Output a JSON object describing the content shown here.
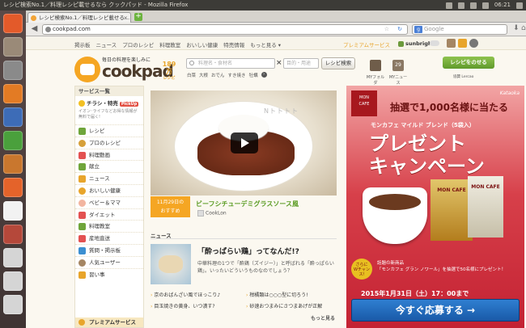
{
  "os": {
    "window_title": "レシピ検索No.1／料理レシピ載せるなら クックパッド - Mozilla Firefox",
    "clock": "06:21"
  },
  "browser": {
    "tab_title": "レシピ検索No.1／料理レシピ載せる...",
    "tab_close": "×",
    "new_tab": "+",
    "url": "cookpad.com",
    "search_placeholder": "Google",
    "search_engine": "g"
  },
  "header": {
    "links": [
      "掲示板",
      "ニュース",
      "プロのレシピ",
      "料理教室",
      "おいしい健康",
      "特売情報",
      "もっと見る ▾"
    ],
    "premium": "プレミアムサービス",
    "username": "sunbright",
    "logo_tagline": "毎日の料理を楽しみに",
    "logo_word": "cookpad",
    "recipe_count": "189万",
    "recipe_count_unit": "レシピ",
    "recipe_placeholder": "料理名・食材名",
    "clear": "×",
    "purpose_placeholder": "目的・用途",
    "search_button": "レシピ検索",
    "keywords": [
      "白菜",
      "大根",
      "おでん",
      "すき焼き",
      "牡蠣"
    ],
    "keywords_more": "›",
    "my_folder": "MYフォルダ",
    "my_news": "MYニュース",
    "my_news_date": "29",
    "post_button": "レシピをのせる",
    "sponsor": "協賛 Lercao"
  },
  "sidebar": {
    "title": "サービス一覧",
    "chirashi": "チラシ・特売",
    "pickup": "PickUp",
    "chirashi_desc": "イオン･ライフなどお得な情報が無料で届く!",
    "items": [
      "レシピ",
      "プロのレシピ",
      "料理動画",
      "献立",
      "ニュース",
      "おいしい健康",
      "ベビー＆ママ",
      "ダイエット",
      "料理教室",
      "産地直送",
      "質問・掲示板",
      "人気ユーザー",
      "習い事"
    ],
    "premium": "プレミアムサービス"
  },
  "featured": {
    "watermark": "Nトトトト",
    "date_line1": "11月29日の",
    "date_line2": "おすすめ",
    "title": "ビーフシチューデミグラスソース風",
    "author": "CookLon"
  },
  "news": {
    "label": "ニュース",
    "headline": "「酔っぱらい鶏」ってなんだ!?",
    "body": "中華料理の1つで「酔鶏（ズイジー）」と呼ばれる「酔っぱらい鶏」。いったいどういうものなのでしょう？",
    "links": [
      "京のおばんざい風でほっこり♪",
      "柑橘類は○○○型に切ろう!",
      "目玉焼きの黄身、いつ潰す?",
      "砂速おつまみにさつまあげが正解"
    ],
    "more": "もっと見る"
  },
  "ad": {
    "brand_line1": "MON",
    "brand_line2": "CAFE",
    "maker": "Kataoka",
    "lottery": "抽選で1,000名様に当たる",
    "product": "モンカフェ マイルド ブレンド（5袋入）",
    "headline1": "プレゼント",
    "headline2": "キャンペーン",
    "pack1": "MON CAFE",
    "pack2": "MON CAFE",
    "more_badge1": "さらに",
    "more_badge2": "Wチャンス!",
    "note1": "話題の新商品",
    "note2": "「モンカフェ グラン ノワール」を抽選で50名様にプレゼント！",
    "deadline": "2015年1月31日（土）17：00まで",
    "apply": "今すぐ応募する →"
  }
}
